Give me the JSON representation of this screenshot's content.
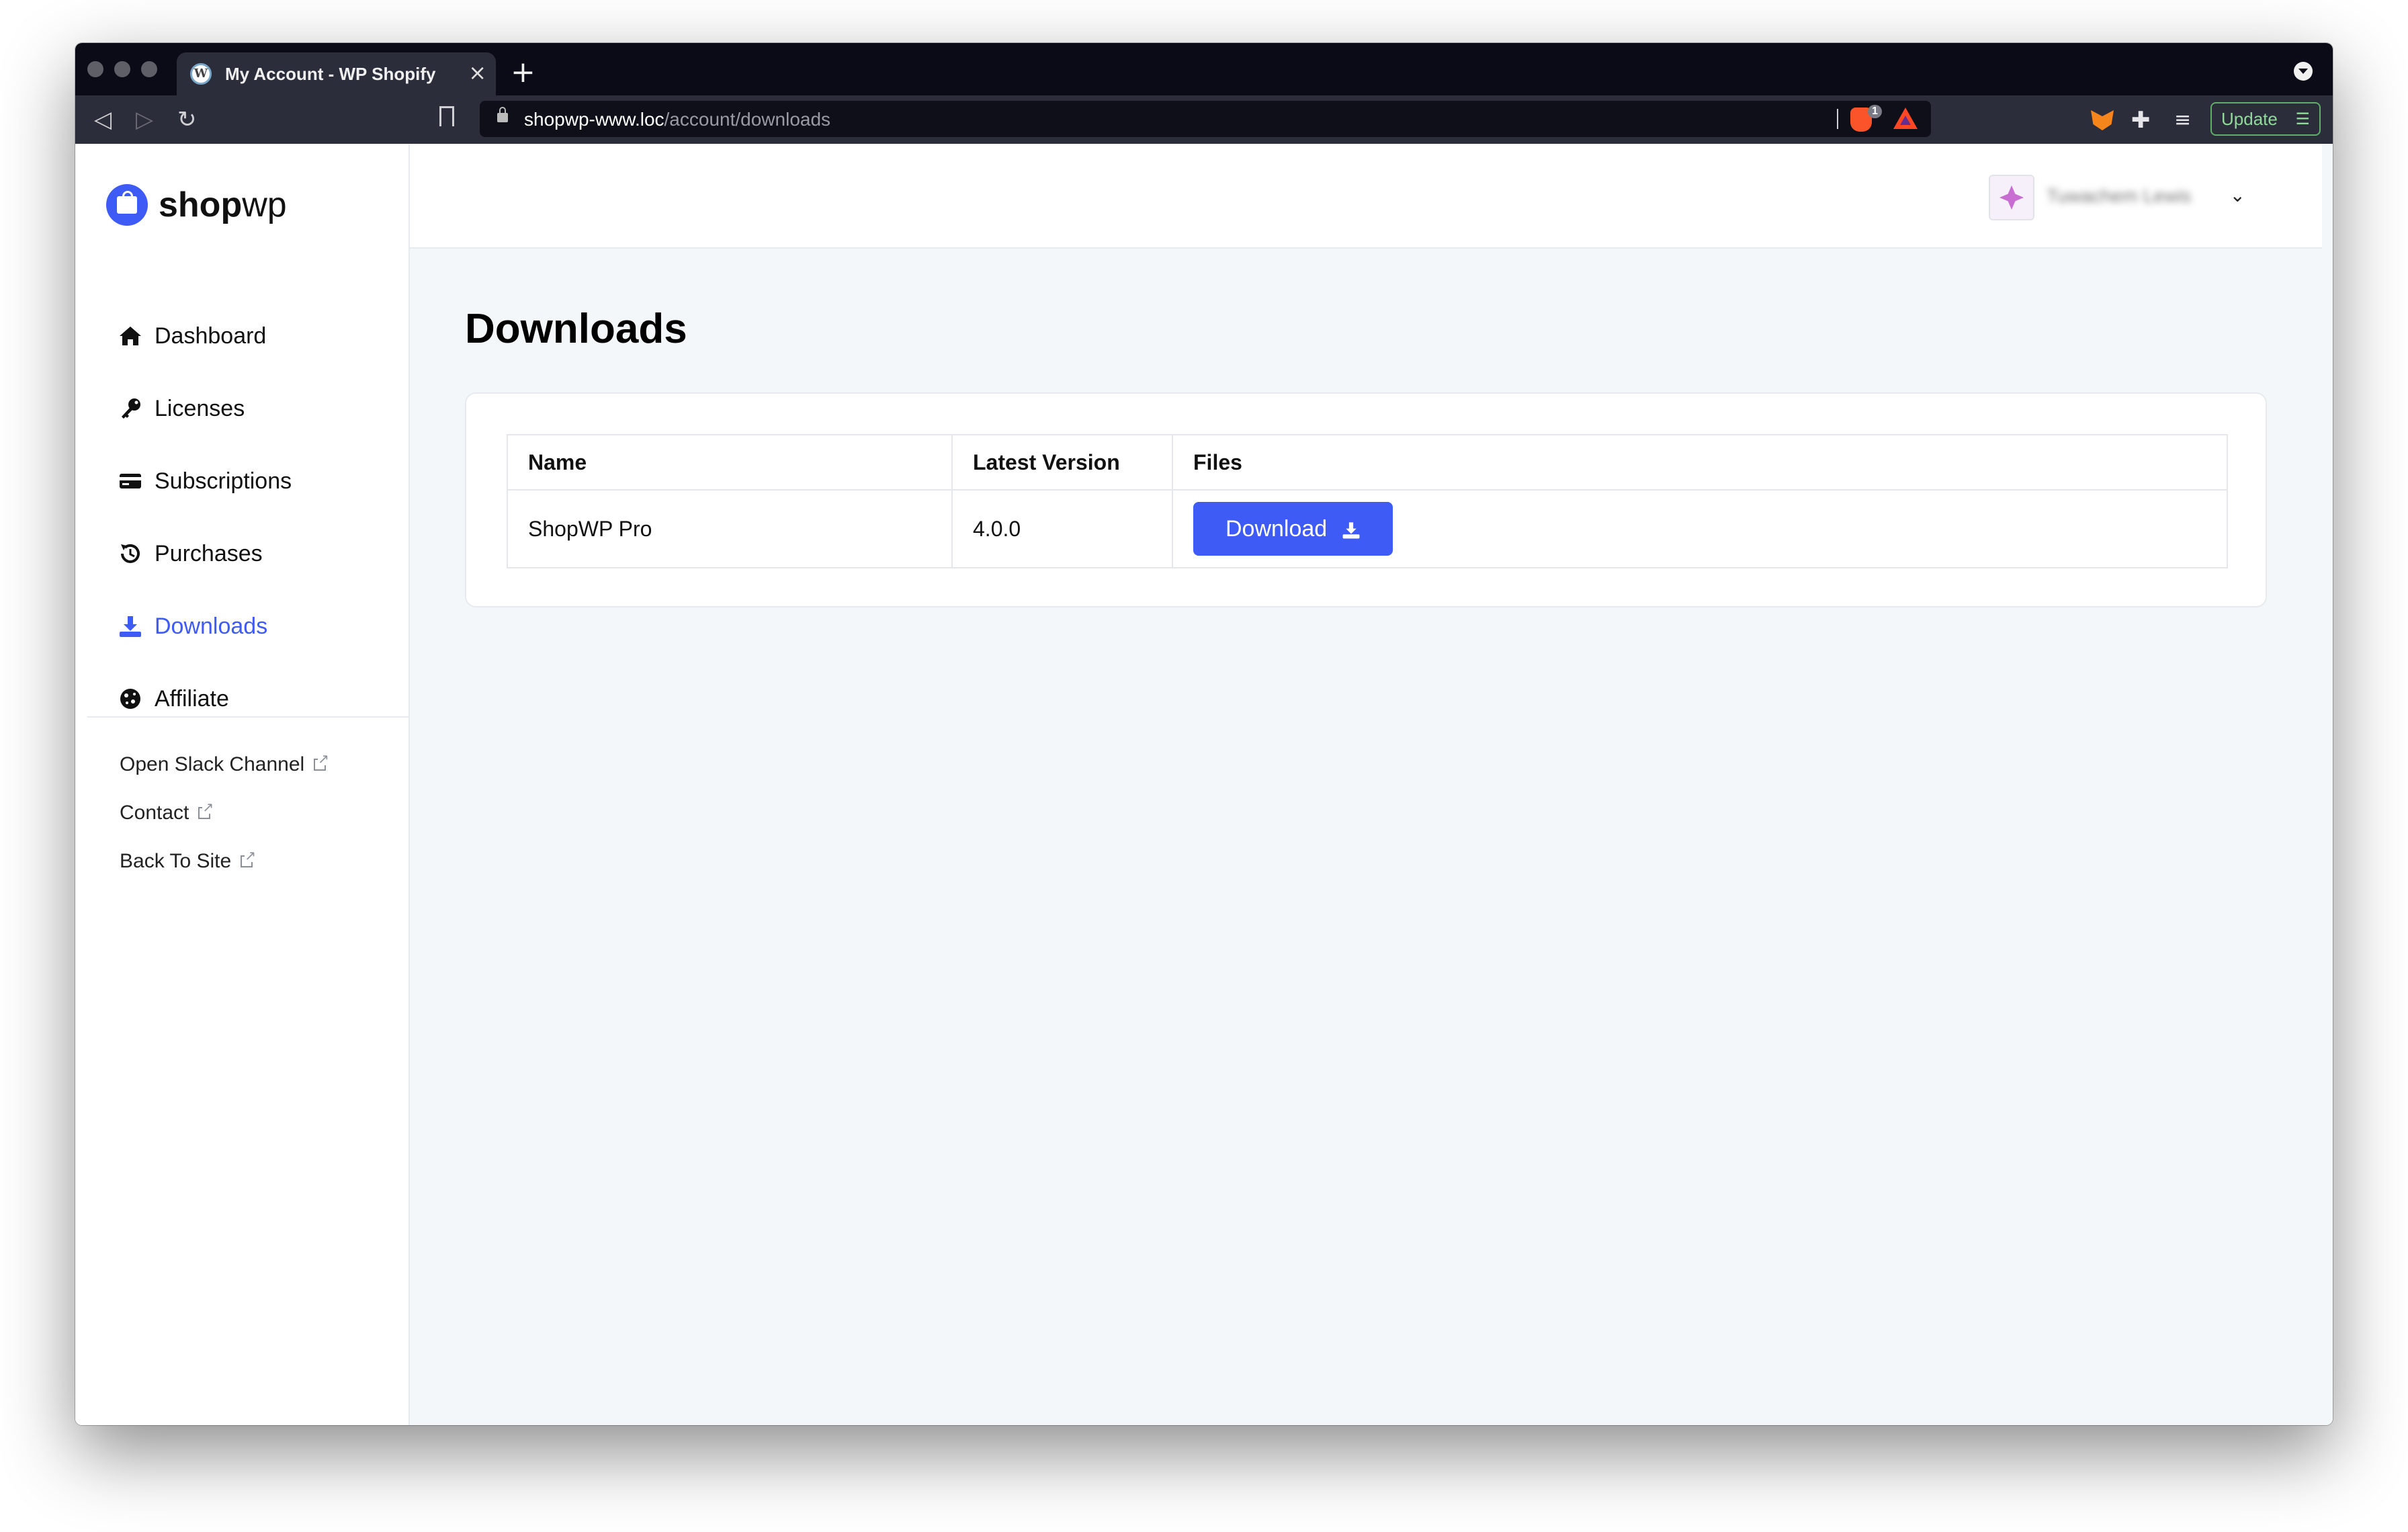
{
  "browser": {
    "tab_title": "My Account - WP Shopify",
    "tab_favicon": "W",
    "url_host": "shopwp-www.loc",
    "url_path": "/account/downloads",
    "brave_badge": "1",
    "update_label": "Update"
  },
  "logo": {
    "bold": "shop",
    "light": "wp"
  },
  "sidebar": {
    "items": [
      {
        "label": "Dashboard",
        "icon": "home-icon"
      },
      {
        "label": "Licenses",
        "icon": "key-icon"
      },
      {
        "label": "Subscriptions",
        "icon": "credit-card-icon"
      },
      {
        "label": "Purchases",
        "icon": "history-icon"
      },
      {
        "label": "Downloads",
        "icon": "download-icon",
        "active": true
      },
      {
        "label": "Affiliate",
        "icon": "cookie-icon"
      }
    ],
    "links": [
      {
        "label": "Open Slack Channel"
      },
      {
        "label": "Contact"
      },
      {
        "label": "Back To Site"
      }
    ]
  },
  "header": {
    "user_name": "Tuwachem Lewis"
  },
  "main": {
    "title": "Downloads",
    "table": {
      "columns": [
        "Name",
        "Latest Version",
        "Files"
      ],
      "rows": [
        {
          "name": "ShopWP Pro",
          "version": "4.0.0",
          "action": "Download"
        }
      ]
    }
  },
  "colors": {
    "accent": "#3e5bf5",
    "chrome": "#0b0b17",
    "page_bg": "#f4f7fa"
  }
}
